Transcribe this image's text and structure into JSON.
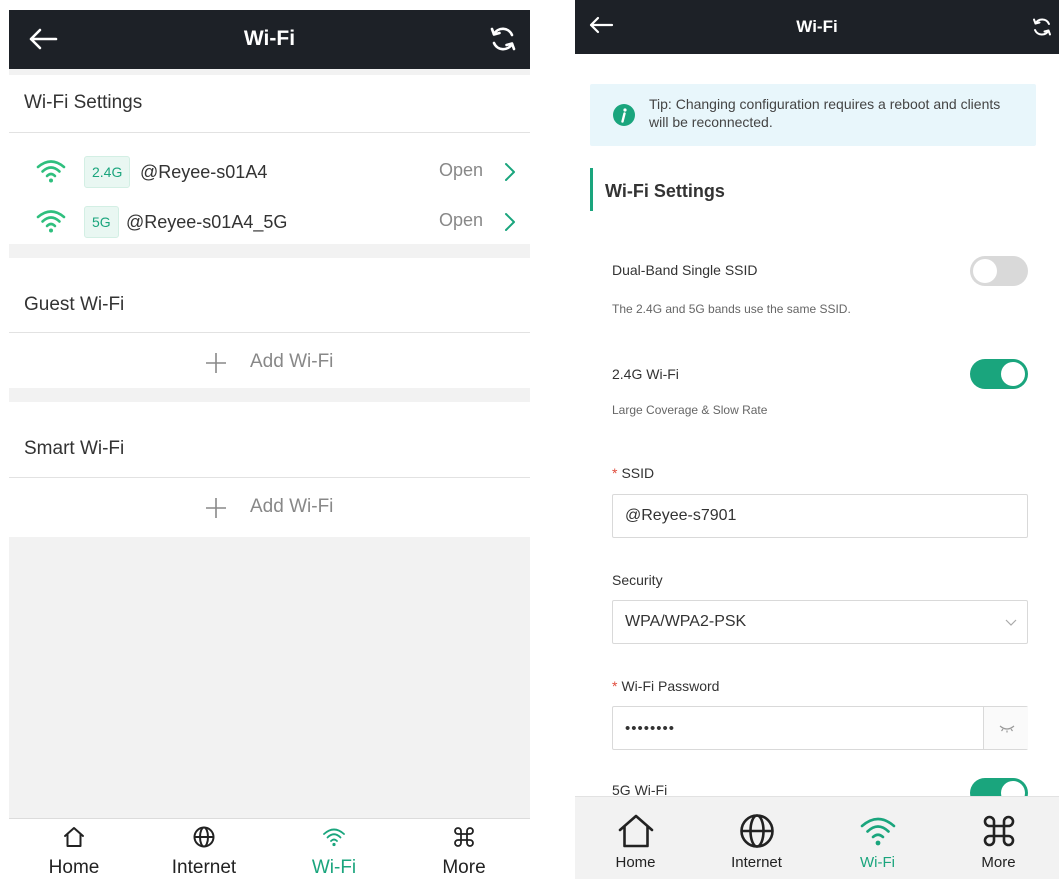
{
  "colors": {
    "accent": "#1aa57d",
    "topbar": "#1d2127",
    "tip_bg": "#e8f6fb",
    "required": "#e04b3c"
  },
  "left": {
    "header": {
      "title": "Wi-Fi",
      "back_icon": "arrow-left-icon",
      "refresh_icon": "refresh-icon"
    },
    "wifi_settings": {
      "title": "Wi-Fi Settings",
      "networks": [
        {
          "band": "2.4G",
          "ssid": "@Reyee-s01A4",
          "status": "Open"
        },
        {
          "band": "5G",
          "ssid": "@Reyee-s01A4_5G",
          "status": "Open"
        }
      ]
    },
    "guest_wifi": {
      "title": "Guest Wi-Fi",
      "add_label": "Add Wi-Fi"
    },
    "smart_wifi": {
      "title": "Smart Wi-Fi",
      "add_label": "Add Wi-Fi"
    },
    "nav": [
      {
        "label": "Home",
        "icon": "home-icon"
      },
      {
        "label": "Internet",
        "icon": "globe-icon"
      },
      {
        "label": "Wi-Fi",
        "icon": "wifi-icon",
        "active": true
      },
      {
        "label": "More",
        "icon": "command-icon"
      }
    ]
  },
  "right": {
    "header": {
      "title": "Wi-Fi",
      "back_icon": "arrow-left-icon",
      "refresh_icon": "refresh-icon"
    },
    "tip": "Tip: Changing configuration requires a reboot and clients will be reconnected.",
    "section_title": "Wi-Fi Settings",
    "dual_band": {
      "label": "Dual-Band Single SSID",
      "hint": "The 2.4G and 5G bands use the same SSID.",
      "enabled": false
    },
    "wifi_24g": {
      "label": "2.4G Wi-Fi",
      "hint": "Large Coverage & Slow Rate",
      "enabled": true
    },
    "ssid": {
      "required_mark": "*",
      "label": "SSID",
      "value": "@Reyee-s7901"
    },
    "security": {
      "label": "Security",
      "value": "WPA/WPA2-PSK"
    },
    "password": {
      "required_mark": "*",
      "label": "Wi-Fi Password",
      "value": "••••••••"
    },
    "wifi_5g": {
      "label": "5G Wi-Fi",
      "enabled": true
    },
    "nav": [
      {
        "label": "Home",
        "icon": "home-icon"
      },
      {
        "label": "Internet",
        "icon": "globe-icon"
      },
      {
        "label": "Wi-Fi",
        "icon": "wifi-icon",
        "active": true
      },
      {
        "label": "More",
        "icon": "command-icon"
      }
    ]
  }
}
